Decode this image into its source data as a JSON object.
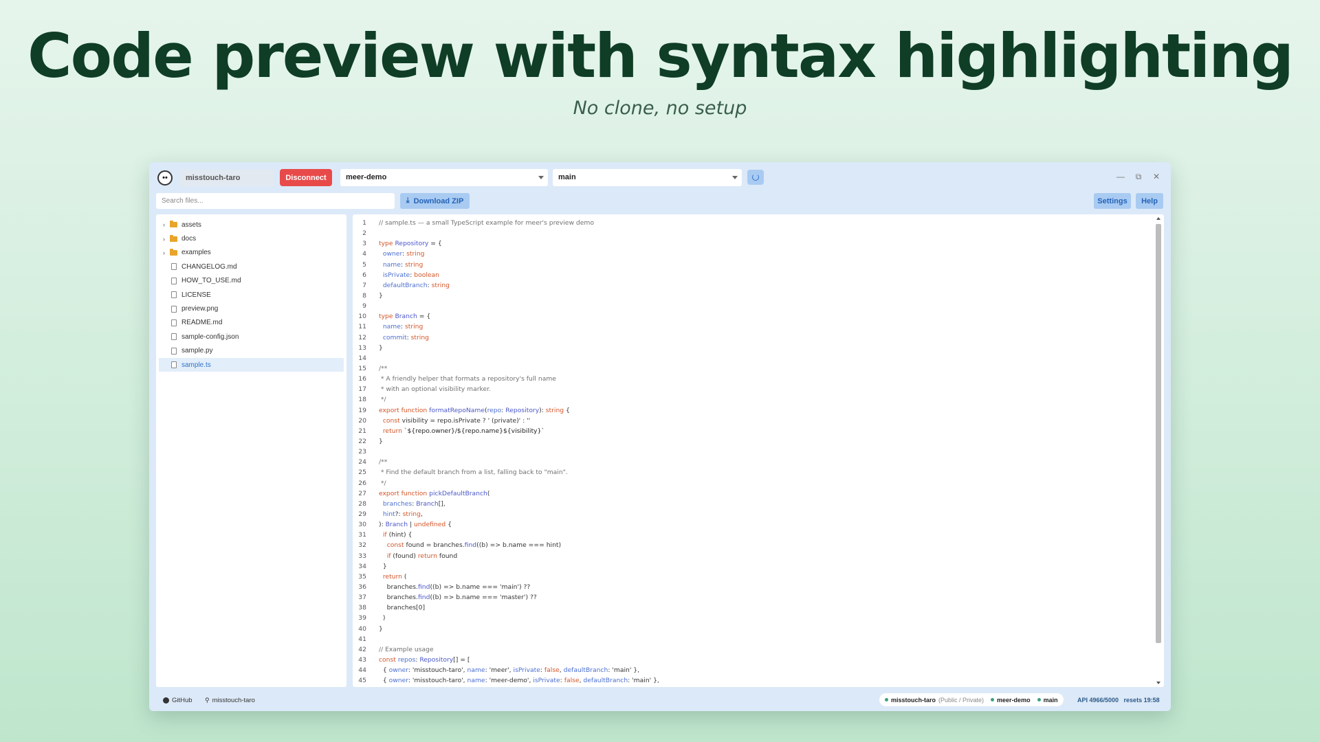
{
  "hero": {
    "title": "Code preview with syntax highlighting",
    "subtitle": "No clone, no setup"
  },
  "app": {
    "logo_glyph": "••",
    "username": "misstouch-taro",
    "disconnect_label": "Disconnect",
    "repo_select": "meer-demo",
    "branch_select": "main",
    "window_controls": {
      "minimize": "—",
      "restore": "⧉",
      "close": "✕"
    }
  },
  "toolbar": {
    "search_placeholder": "Search files...",
    "download_label": "Download ZIP",
    "download_icon": "⤓",
    "settings_label": "Settings",
    "help_label": "Help"
  },
  "files": [
    {
      "name": "assets",
      "type": "folder"
    },
    {
      "name": "docs",
      "type": "folder"
    },
    {
      "name": "examples",
      "type": "folder"
    },
    {
      "name": "CHANGELOG.md",
      "type": "file"
    },
    {
      "name": "HOW_TO_USE.md",
      "type": "file"
    },
    {
      "name": "LICENSE",
      "type": "file"
    },
    {
      "name": "preview.png",
      "type": "file"
    },
    {
      "name": "README.md",
      "type": "file"
    },
    {
      "name": "sample-config.json",
      "type": "file"
    },
    {
      "name": "sample.py",
      "type": "file"
    },
    {
      "name": "sample.ts",
      "type": "file",
      "active": true
    }
  ],
  "colors": {
    "comment": "#707070",
    "keyword": "#d2562a",
    "type": "#4a57c8",
    "string": "#222222",
    "property": "#4b6fd0",
    "plain": "#333333"
  },
  "code": [
    [
      [
        "c",
        "// sample.ts — a small TypeScript example for meer's preview demo"
      ]
    ],
    [],
    [
      [
        "k",
        "type "
      ],
      [
        "t",
        "Repository"
      ],
      [
        "p",
        " = {"
      ]
    ],
    [
      [
        "p",
        "  "
      ],
      [
        "r",
        "owner"
      ],
      [
        "p",
        ": "
      ],
      [
        "k",
        "string"
      ]
    ],
    [
      [
        "p",
        "  "
      ],
      [
        "r",
        "name"
      ],
      [
        "p",
        ": "
      ],
      [
        "k",
        "string"
      ]
    ],
    [
      [
        "p",
        "  "
      ],
      [
        "r",
        "isPrivate"
      ],
      [
        "p",
        ": "
      ],
      [
        "k",
        "boolean"
      ]
    ],
    [
      [
        "p",
        "  "
      ],
      [
        "r",
        "defaultBranch"
      ],
      [
        "p",
        ": "
      ],
      [
        "k",
        "string"
      ]
    ],
    [
      [
        "p",
        "}"
      ]
    ],
    [],
    [
      [
        "k",
        "type "
      ],
      [
        "t",
        "Branch"
      ],
      [
        "p",
        " = {"
      ]
    ],
    [
      [
        "p",
        "  "
      ],
      [
        "r",
        "name"
      ],
      [
        "p",
        ": "
      ],
      [
        "k",
        "string"
      ]
    ],
    [
      [
        "p",
        "  "
      ],
      [
        "r",
        "commit"
      ],
      [
        "p",
        ": "
      ],
      [
        "k",
        "string"
      ]
    ],
    [
      [
        "p",
        "}"
      ]
    ],
    [],
    [
      [
        "c",
        "/**"
      ]
    ],
    [
      [
        "c",
        " * A friendly helper that formats a repository's full name"
      ]
    ],
    [
      [
        "c",
        " * with an optional visibility marker."
      ]
    ],
    [
      [
        "c",
        " */"
      ]
    ],
    [
      [
        "k",
        "export function "
      ],
      [
        "t",
        "formatRepoName"
      ],
      [
        "p",
        "("
      ],
      [
        "r",
        "repo"
      ],
      [
        "p",
        ": "
      ],
      [
        "t",
        "Repository"
      ],
      [
        "p",
        "): "
      ],
      [
        "k",
        "string"
      ],
      [
        "p",
        " {"
      ]
    ],
    [
      [
        "p",
        "  "
      ],
      [
        "k",
        "const "
      ],
      [
        "p",
        "visibility = repo.isPrivate ? ' (private)' : ''"
      ]
    ],
    [
      [
        "p",
        "  "
      ],
      [
        "k",
        "return "
      ],
      [
        "s",
        "`${repo.owner}/${repo.name}${visibility}`"
      ]
    ],
    [
      [
        "p",
        "}"
      ]
    ],
    [],
    [
      [
        "c",
        "/**"
      ]
    ],
    [
      [
        "c",
        " * Find the default branch from a list, falling back to \"main\"."
      ]
    ],
    [
      [
        "c",
        " */"
      ]
    ],
    [
      [
        "k",
        "export function "
      ],
      [
        "t",
        "pickDefaultBranch"
      ],
      [
        "p",
        "("
      ]
    ],
    [
      [
        "p",
        "  "
      ],
      [
        "r",
        "branches"
      ],
      [
        "p",
        ": "
      ],
      [
        "t",
        "Branch"
      ],
      [
        "p",
        "[],"
      ]
    ],
    [
      [
        "p",
        "  "
      ],
      [
        "r",
        "hint"
      ],
      [
        "p",
        "?: "
      ],
      [
        "k",
        "string"
      ],
      [
        "p",
        ","
      ]
    ],
    [
      [
        "p",
        "): "
      ],
      [
        "t",
        "Branch"
      ],
      [
        "p",
        " | "
      ],
      [
        "k",
        "undefined"
      ],
      [
        "p",
        " {"
      ]
    ],
    [
      [
        "p",
        "  "
      ],
      [
        "k",
        "if "
      ],
      [
        "p",
        "(hint) {"
      ]
    ],
    [
      [
        "p",
        "    "
      ],
      [
        "k",
        "const "
      ],
      [
        "p",
        "found = branches."
      ],
      [
        "t",
        "find"
      ],
      [
        "p",
        "((b) => b.name === hint)"
      ]
    ],
    [
      [
        "p",
        "    "
      ],
      [
        "k",
        "if "
      ],
      [
        "p",
        "(found) "
      ],
      [
        "k",
        "return "
      ],
      [
        "p",
        "found"
      ]
    ],
    [
      [
        "p",
        "  }"
      ]
    ],
    [
      [
        "p",
        "  "
      ],
      [
        "k",
        "return "
      ],
      [
        "p",
        "("
      ]
    ],
    [
      [
        "p",
        "    branches."
      ],
      [
        "t",
        "find"
      ],
      [
        "p",
        "((b) => b.name === 'main') ??"
      ]
    ],
    [
      [
        "p",
        "    branches."
      ],
      [
        "t",
        "find"
      ],
      [
        "p",
        "((b) => b.name === 'master') ??"
      ]
    ],
    [
      [
        "p",
        "    branches[0]"
      ]
    ],
    [
      [
        "p",
        "  )"
      ]
    ],
    [
      [
        "p",
        "}"
      ]
    ],
    [],
    [
      [
        "c",
        "// Example usage"
      ]
    ],
    [
      [
        "k",
        "const "
      ],
      [
        "r",
        "repos"
      ],
      [
        "p",
        ": "
      ],
      [
        "t",
        "Repository"
      ],
      [
        "p",
        "[] = ["
      ]
    ],
    [
      [
        "p",
        "  { "
      ],
      [
        "r",
        "owner"
      ],
      [
        "p",
        ": 'misstouch-taro', "
      ],
      [
        "r",
        "name"
      ],
      [
        "p",
        ": 'meer', "
      ],
      [
        "r",
        "isPrivate"
      ],
      [
        "p",
        ": "
      ],
      [
        "k",
        "false"
      ],
      [
        "p",
        ", "
      ],
      [
        "r",
        "defaultBranch"
      ],
      [
        "p",
        ": 'main' },"
      ]
    ],
    [
      [
        "p",
        "  { "
      ],
      [
        "r",
        "owner"
      ],
      [
        "p",
        ": 'misstouch-taro', "
      ],
      [
        "r",
        "name"
      ],
      [
        "p",
        ": 'meer-demo', "
      ],
      [
        "r",
        "isPrivate"
      ],
      [
        "p",
        ": "
      ],
      [
        "k",
        "false"
      ],
      [
        "p",
        ", "
      ],
      [
        "r",
        "defaultBranch"
      ],
      [
        "p",
        ": 'main' },"
      ]
    ],
    [
      [
        "p",
        "]"
      ]
    ]
  ],
  "status": {
    "github_label": "GitHub",
    "user_label": "misstouch-taro",
    "pill_user": "misstouch-taro",
    "pill_visibility": "(Public / Private)",
    "pill_repo": "meer-demo",
    "pill_branch": "main",
    "api": "API 4966/5000   resets 19:58"
  }
}
